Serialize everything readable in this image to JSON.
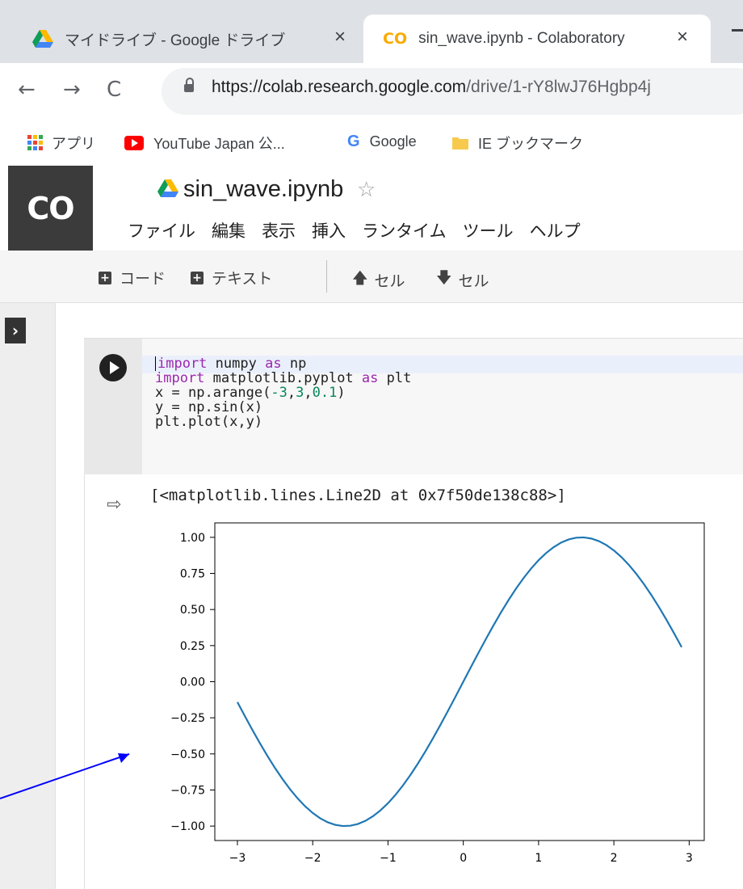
{
  "browser": {
    "tabs": [
      {
        "title": "マイドライブ - Google ドライブ",
        "icon": "google-drive-icon",
        "active": false
      },
      {
        "title": "sin_wave.ipynb - Colaboratory",
        "icon": "colab-icon",
        "active": true
      }
    ],
    "url_host": "https://colab.research.google.com",
    "url_path": "/drive/1-rY8lwJ76Hgbp4j",
    "bookmarks": [
      {
        "label": "アプリ",
        "icon": "apps-grid-icon"
      },
      {
        "label": "YouTube Japan 公...",
        "icon": "youtube-icon"
      },
      {
        "label": "Google",
        "icon": "google-icon"
      },
      {
        "label": "IE ブックマーク",
        "icon": "folder-icon"
      }
    ]
  },
  "colab": {
    "logo": "CO",
    "notebook_title": "sin_wave.ipynb",
    "menu": [
      "ファイル",
      "編集",
      "表示",
      "挿入",
      "ランタイム",
      "ツール",
      "ヘルプ"
    ],
    "toolbar": {
      "add_code": "コード",
      "add_text": "テキスト",
      "cell_up": "セル",
      "cell_down": "セル"
    }
  },
  "cell": {
    "code_lines": [
      "import numpy as np",
      "import matplotlib.pyplot as plt",
      "x = np.arange(-3,3,0.1)",
      "y = np.sin(x)",
      "plt.plot(x,y)"
    ],
    "output_text": "[<matplotlib.lines.Line2D at 0x7f50de138c88>]"
  },
  "chart_data": {
    "type": "line",
    "title": "",
    "xlabel": "",
    "ylabel": "",
    "xlim": [
      -3.3,
      3.2
    ],
    "ylim": [
      -1.1,
      1.1
    ],
    "x_ticks": [
      -3,
      -2,
      -1,
      0,
      1,
      2,
      3
    ],
    "x_tick_labels": [
      "−3",
      "−2",
      "−1",
      "0",
      "1",
      "2",
      "3"
    ],
    "y_ticks": [
      1.0,
      0.75,
      0.5,
      0.25,
      0.0,
      -0.25,
      -0.5,
      -0.75,
      -1.0
    ],
    "y_tick_labels": [
      "1.00",
      "0.75",
      "0.50",
      "0.25",
      "0.00",
      "−0.25",
      "−0.50",
      "−0.75",
      "−1.00"
    ],
    "series": [
      {
        "color": "#1f77b4",
        "x_start": -3.0,
        "x_step": 0.1,
        "x_end": 2.9,
        "function": "sin"
      }
    ],
    "grid": false
  },
  "colors": {
    "line": "#1f77b4",
    "annotation_arrow": "#0000ff"
  }
}
